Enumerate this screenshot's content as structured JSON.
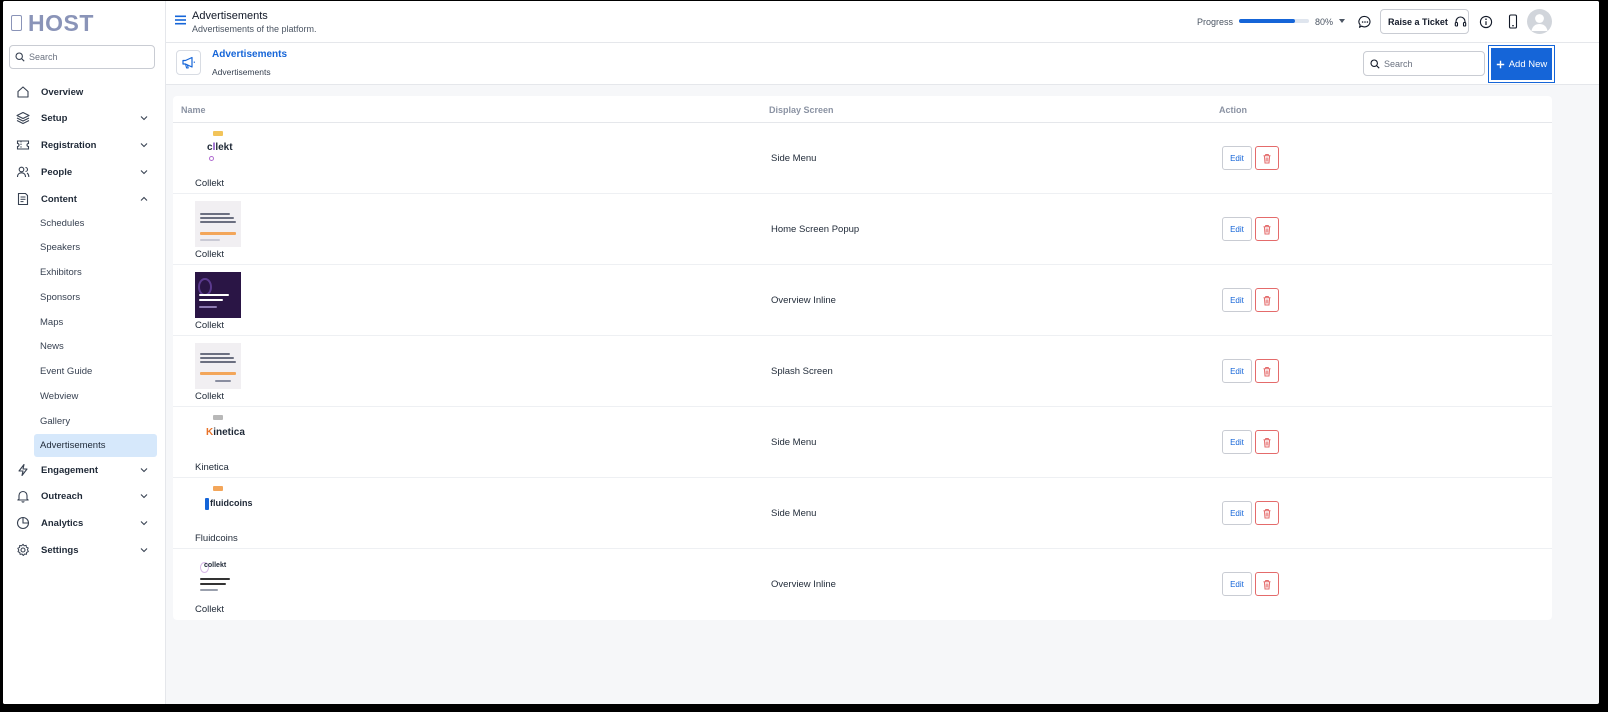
{
  "app": {
    "logo_text": "HOST"
  },
  "sidebar": {
    "search_placeholder": "Search",
    "nav": [
      {
        "label": "Overview",
        "icon": "home-icon"
      },
      {
        "label": "Setup",
        "icon": "layers-icon"
      },
      {
        "label": "Registration",
        "icon": "ticket-icon"
      },
      {
        "label": "People",
        "icon": "people-icon"
      },
      {
        "label": "Content",
        "icon": "content-icon"
      },
      {
        "label": "Engagement",
        "icon": "lightning-icon"
      },
      {
        "label": "Outreach",
        "icon": "bell-icon"
      },
      {
        "label": "Analytics",
        "icon": "pie-icon"
      },
      {
        "label": "Settings",
        "icon": "gear-icon"
      }
    ],
    "content_sub": [
      "Schedules",
      "Speakers",
      "Exhibitors",
      "Sponsors",
      "Maps",
      "News",
      "Event Guide",
      "Webview",
      "Gallery",
      "Advertisements"
    ],
    "active_sub": "Advertisements"
  },
  "topbar": {
    "title": "Advertisements",
    "subtitle": "Advertisements of the platform.",
    "progress_label": "Progress",
    "progress_value": "80%",
    "progress_fraction": 0.8,
    "raise_ticket": "Raise a Ticket"
  },
  "content_header": {
    "title": "Advertisements",
    "breadcrumb": "Advertisements",
    "search_placeholder": "Search",
    "add_new": "Add New"
  },
  "table": {
    "columns": [
      "Name",
      "Display Screen",
      "Action"
    ],
    "edit_label": "Edit",
    "rows": [
      {
        "name": "Collekt",
        "screen": "Side Menu",
        "thumb": "collekt-logo"
      },
      {
        "name": "Collekt",
        "screen": "Home Screen Popup",
        "thumb": "light-poster"
      },
      {
        "name": "Collekt",
        "screen": "Overview Inline",
        "thumb": "dark-poster"
      },
      {
        "name": "Collekt",
        "screen": "Splash Screen",
        "thumb": "light-poster"
      },
      {
        "name": "Kinetica",
        "screen": "Side Menu",
        "thumb": "kinetica-logo"
      },
      {
        "name": "Fluidcoins",
        "screen": "Side Menu",
        "thumb": "fluidcoins-logo"
      },
      {
        "name": "Collekt",
        "screen": "Overview Inline",
        "thumb": "collekt-poster"
      }
    ]
  },
  "colors": {
    "accent": "#1565d8",
    "danger": "#e46b6b",
    "active_bg": "#d6e8fb"
  }
}
